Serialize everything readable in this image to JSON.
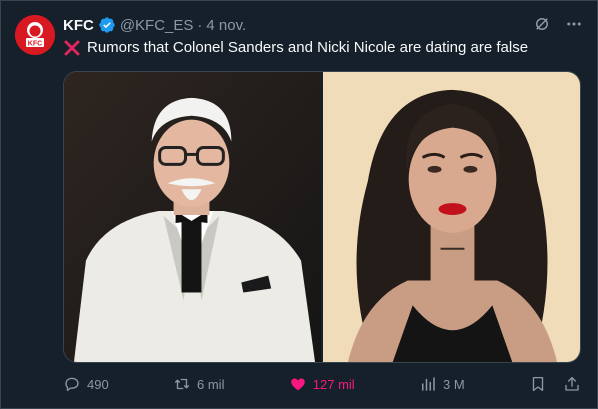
{
  "tweet": {
    "author_name": "KFC",
    "handle": "@KFC_ES",
    "separator": "·",
    "date": "4 nov.",
    "text": "Rumors that Colonel Sanders and Nicki Nicole are dating are false"
  },
  "stats": {
    "replies": "490",
    "retweets": "6 mil",
    "likes": "127 mil",
    "views": "3 M"
  },
  "colors": {
    "background": "#15202b",
    "muted": "#8b98a5",
    "like": "#f91880",
    "verified": "#1d9bf0",
    "brand": "#d81921"
  },
  "icons": [
    "kfc-logo-icon",
    "verified-badge-icon",
    "grok-icon",
    "more-icon",
    "cross-mark-icon",
    "reply-icon",
    "retweet-icon",
    "heart-icon",
    "views-icon",
    "bookmark-icon",
    "share-icon"
  ]
}
